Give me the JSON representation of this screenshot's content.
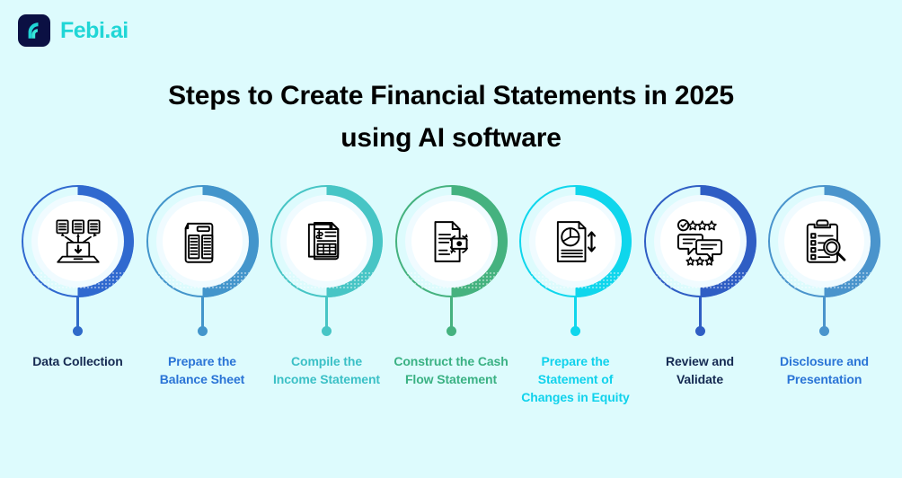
{
  "brand": {
    "name": "Febi.ai",
    "logo_icon": "febi-f-logomark",
    "logo_bg": "#0b1043",
    "logo_glyph_color": "#20d6d6",
    "text_color": "#20d6d6"
  },
  "page": {
    "background": "#ddfbfd",
    "title": "Steps to Create Financial Statements in 2025 using AI software",
    "title_line1": "Steps to Create Financial Statements in 2025",
    "title_line2": "using AI software",
    "title_color": "#000000"
  },
  "steps": [
    {
      "label": "Data Collection",
      "icon": "documents-to-laptop-icon",
      "ring_color": "#3069cf",
      "label_color": "#152a52",
      "connector_color": "#2f6ac9"
    },
    {
      "label": "Prepare the Balance Sheet",
      "icon": "balance-sheet-document-icon",
      "ring_color": "#4395cb",
      "label_color": "#2a74d6",
      "connector_color": "#4395cb"
    },
    {
      "label": "Compile the Income Statement",
      "icon": "invoice-stack-icon",
      "ring_color": "#47c5c5",
      "label_color": "#3bc0c6",
      "connector_color": "#47c5c5"
    },
    {
      "label": "Construct the Cash Flow Statement",
      "icon": "cash-flow-document-icon",
      "ring_color": "#45b27f",
      "label_color": "#3ab183",
      "connector_color": "#45b27f"
    },
    {
      "label": "Prepare the Statement of Changes in Equity",
      "icon": "pie-chart-report-icon",
      "ring_color": "#0fd6ec",
      "label_color": "#10d2ec",
      "connector_color": "#0fd6ec"
    },
    {
      "label": "Review and Validate",
      "icon": "review-chat-stars-icon",
      "ring_color": "#2f5ec4",
      "label_color": "#152a52",
      "connector_color": "#2f5ec4"
    },
    {
      "label": "Disclosure and Presentation",
      "icon": "clipboard-magnifier-icon",
      "ring_color": "#4a94cc",
      "label_color": "#2a74d6",
      "connector_color": "#4a94cc"
    }
  ]
}
